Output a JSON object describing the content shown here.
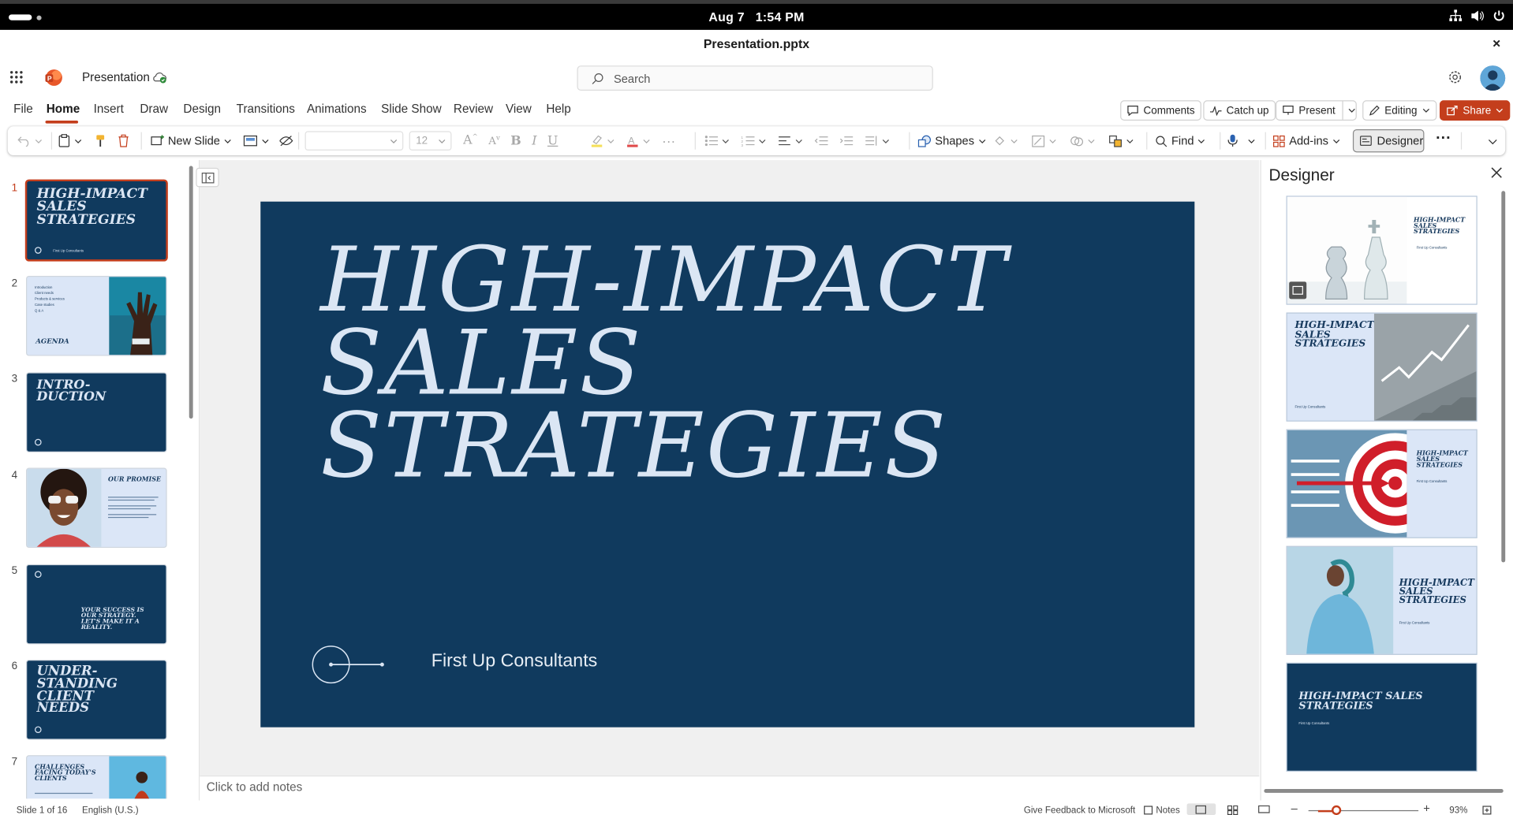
{
  "os": {
    "date": "Aug 7",
    "time": "1:54 PM"
  },
  "window": {
    "title": "Presentation.pptx"
  },
  "app": {
    "name": "Presentation",
    "search_placeholder": "Search"
  },
  "menu": {
    "tabs": [
      "File",
      "Home",
      "Insert",
      "Draw",
      "Design",
      "Transitions",
      "Animations",
      "Slide Show",
      "Review",
      "View",
      "Help"
    ],
    "active_tab": "Home",
    "comments": "Comments",
    "catchup": "Catch up",
    "present": "Present",
    "editing": "Editing",
    "share": "Share"
  },
  "ribbon": {
    "new_slide": "New Slide",
    "font_size": "12",
    "shapes": "Shapes",
    "find": "Find",
    "addins": "Add-ins",
    "designer": "Designer"
  },
  "slides": {
    "numbers": [
      "1",
      "2",
      "3",
      "4",
      "5",
      "6",
      "7"
    ],
    "t1": "HIGH-IMPACT SALES STRATEGIES",
    "t1_sub": "First Up Consultants",
    "t2": "AGENDA",
    "t2_items": [
      "Introduction",
      "Client needs",
      "Products & services",
      "Case studies",
      "Q & A"
    ],
    "t3": "INTRO-DUCTION",
    "t4": "OUR PROMISE",
    "t5": "YOUR SUCCESS IS OUR STRATEGY. LET'S MAKE IT A REALITY.",
    "t6": "UNDER-STANDING CLIENT NEEDS",
    "t7": "CHALLENGES FACING TODAY'S CLIENTS"
  },
  "main_slide": {
    "title_lines": [
      "HIGH-IMPACT",
      "SALES",
      "STRATEGIES"
    ],
    "subtitle": "First Up Consultants"
  },
  "notes_placeholder": "Click to add notes",
  "designer": {
    "title": "Designer",
    "card_title": "HIGH-IMPACT SALES STRATEGIES",
    "card_sub": "First Up Consultants"
  },
  "status": {
    "slide_count": "Slide 1 of 16",
    "language": "English (U.S.)",
    "feedback": "Give Feedback to Microsoft",
    "notes": "Notes",
    "zoom": "93%"
  }
}
